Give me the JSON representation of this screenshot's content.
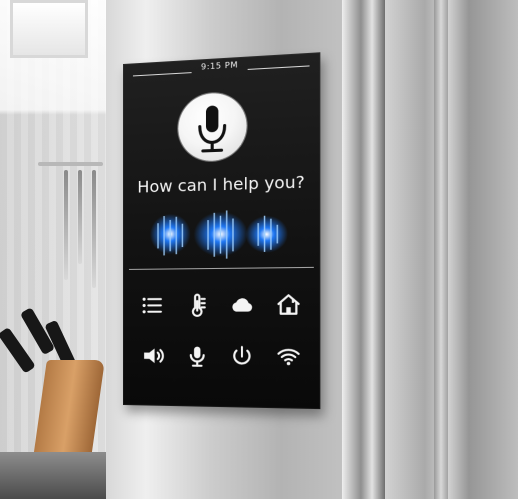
{
  "scene": {
    "background": "kitchen-refrigerator-photo"
  },
  "screen": {
    "time": "9:15 PM",
    "prompt": "How can I help you?",
    "voice_icon": "microphone-icon",
    "voice_wave": "blue-waveform"
  },
  "controls": [
    {
      "icon": "list-icon"
    },
    {
      "icon": "thermometer-icon"
    },
    {
      "icon": "cloud-icon"
    },
    {
      "icon": "home-icon"
    },
    {
      "icon": "speaker-icon"
    },
    {
      "icon": "microphone-icon"
    },
    {
      "icon": "power-icon"
    },
    {
      "icon": "wifi-icon"
    }
  ],
  "colors": {
    "screen": "#111111",
    "text": "#f4f4f4",
    "wave_blue": "#1f7cff"
  }
}
